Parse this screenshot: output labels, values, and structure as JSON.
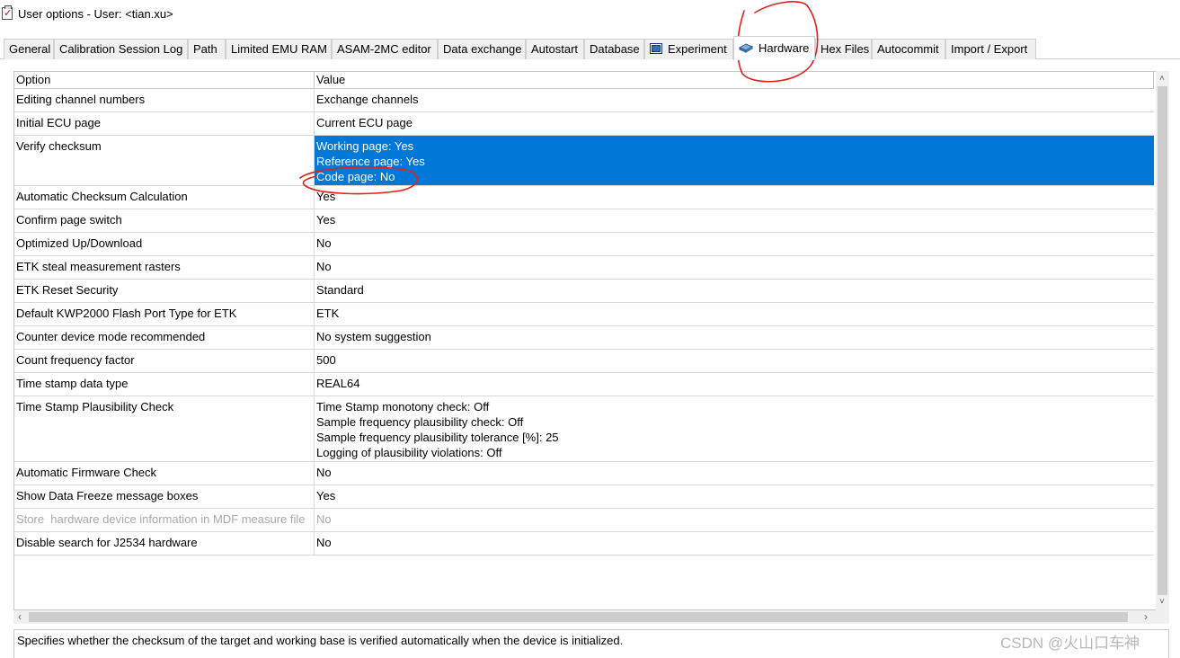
{
  "window": {
    "title": "User options - User: <tian.xu>",
    "app_icon": "checklist-icon"
  },
  "tabs": [
    {
      "label": "General"
    },
    {
      "label": "Calibration Session Log"
    },
    {
      "label": "Path"
    },
    {
      "label": "Limited EMU RAM"
    },
    {
      "label": "ASAM-2MC editor"
    },
    {
      "label": "Data exchange"
    },
    {
      "label": "Autostart"
    },
    {
      "label": "Database"
    },
    {
      "label": "Experiment",
      "icon": "experiment-icon"
    },
    {
      "label": "Hardware",
      "icon": "hardware-icon",
      "active": true
    },
    {
      "label": "Hex Files"
    },
    {
      "label": "Autocommit"
    },
    {
      "label": "Import / Export"
    }
  ],
  "grid": {
    "headers": {
      "option": "Option",
      "value": "Value"
    },
    "rows": [
      {
        "option": "Editing channel numbers",
        "value": "Exchange channels"
      },
      {
        "option": "Initial ECU page",
        "value": "Current ECU page"
      },
      {
        "option": "Verify checksum",
        "value": "Working page: Yes\nReference page: Yes\nCode page: No",
        "selected": true
      },
      {
        "option": "Automatic Checksum Calculation",
        "value": "Yes"
      },
      {
        "option": "Confirm page switch",
        "value": "Yes"
      },
      {
        "option": "Optimized Up/Download",
        "value": "No"
      },
      {
        "option": "ETK steal measurement rasters",
        "value": "No"
      },
      {
        "option": "ETK Reset Security",
        "value": "Standard"
      },
      {
        "option": "Default KWP2000 Flash Port Type for ETK",
        "value": "ETK"
      },
      {
        "option": "Counter device mode recommended",
        "value": "No system suggestion"
      },
      {
        "option": "Count frequency factor",
        "value": "500"
      },
      {
        "option": "Time stamp data type",
        "value": "REAL64"
      },
      {
        "option": "Time Stamp Plausibility Check",
        "value": "Time Stamp monotony check: Off\nSample frequency plausibility check: Off\nSample frequency plausibility tolerance [%]: 25\nLogging of plausibility violations: Off"
      },
      {
        "option": "Automatic Firmware Check",
        "value": "No"
      },
      {
        "option": "Show Data Freeze message boxes",
        "value": "Yes"
      },
      {
        "option": "Store  hardware device information in MDF measure file",
        "value": "No",
        "disabled": true
      },
      {
        "option": "Disable search for J2534 hardware",
        "value": "No"
      }
    ]
  },
  "status": {
    "description": "Specifies whether the checksum of the target and working base is verified automatically when the device is initialized."
  },
  "watermark": "CSDN @火山口车神",
  "annotation_color": "#e0201c"
}
